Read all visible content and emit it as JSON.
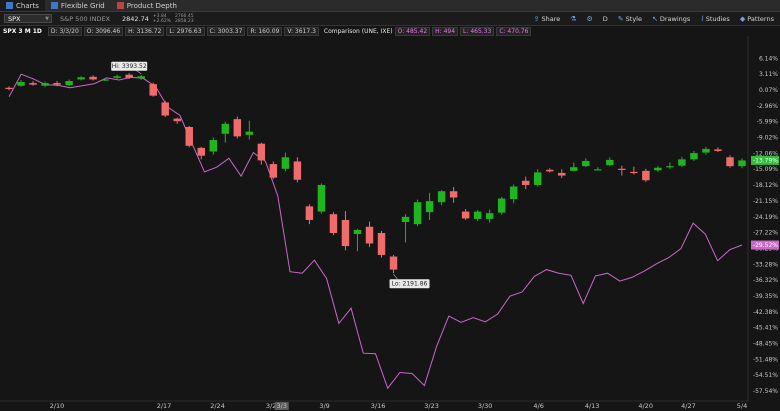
{
  "tabs": [
    {
      "label": "Charts",
      "active": true
    },
    {
      "label": "Flexible Grid",
      "active": false
    },
    {
      "label": "Product Depth",
      "active": false
    }
  ],
  "toolbar": {
    "symbol": "SPX",
    "name": "S&P 500 INDEX",
    "last": "2842.74",
    "change1": "+3.84",
    "change2": "+2.62%",
    "change3": "2766.45",
    "change4": "2858.23",
    "share": "Share",
    "style": "Style",
    "drawings": "Drawings",
    "studies": "Studies",
    "patterns": "Patterns",
    "period_letter": "D"
  },
  "legend": {
    "label": "SPX 3 M 1D",
    "date": "D: 3/3/20",
    "open": "O: 3096.46",
    "high": "H: 3136.72",
    "low": "L: 2976.63",
    "close": "C: 3003.37",
    "change": "R: 160.09",
    "volume": "V: 3617.3",
    "comparison": "Comparison (UNE, IXE)",
    "c_open": "O: 485.42",
    "c_high": "H: 494",
    "c_low": "L: 465.33",
    "c_close": "C: 470.76"
  },
  "colors": {
    "up": "#1fb51f",
    "down": "#f06c6c",
    "comparison": "#c968c8",
    "current_price_tag": "#2fbf3b",
    "comparison_tag": "#c968c8"
  },
  "chart_data": {
    "type": "candlestick",
    "y_axis_labels": [
      "6.14%",
      "3.11%",
      "0.07%",
      "-2.96%",
      "-5.99%",
      "-9.02%",
      "-12.06%",
      "-15.09%",
      "-18.12%",
      "-21.15%",
      "-24.19%",
      "-27.22%",
      "-30.25%",
      "-33.28%",
      "-36.32%",
      "-39.35%",
      "-42.38%",
      "-45.41%",
      "-48.45%",
      "-51.48%",
      "-54.51%",
      "-57.54%"
    ],
    "x_axis_labels": [
      "2/10",
      "2/17",
      "2/24",
      "3/2",
      "3/3",
      "3/9",
      "3/16",
      "3/23",
      "3/30",
      "4/6",
      "4/13",
      "4/20",
      "4/27",
      "5/4"
    ],
    "highlighted_x_label": "3/3",
    "candles": [
      {
        "o": 0.5,
        "c": 0.3,
        "h": 0.8,
        "l": 0.0
      },
      {
        "o": 0.9,
        "c": 1.6,
        "h": 2.0,
        "l": 0.7
      },
      {
        "o": 1.4,
        "c": 1.1,
        "h": 1.8,
        "l": 0.9
      },
      {
        "o": 0.9,
        "c": 1.4,
        "h": 1.7,
        "l": 0.6
      },
      {
        "o": 1.4,
        "c": 1.1,
        "h": 1.8,
        "l": 0.8
      },
      {
        "o": 1.0,
        "c": 1.8,
        "h": 2.1,
        "l": 0.8
      },
      {
        "o": 2.1,
        "c": 2.5,
        "h": 2.7,
        "l": 1.9
      },
      {
        "o": 2.6,
        "c": 2.1,
        "h": 2.9,
        "l": 1.9
      },
      {
        "o": 2.0,
        "c": 2.1,
        "h": 2.4,
        "l": 1.8
      },
      {
        "o": 2.4,
        "c": 2.7,
        "h": 3.0,
        "l": 2.2
      },
      {
        "o": 3.0,
        "c": 2.4,
        "h": 3.3,
        "l": 2.2
      },
      {
        "o": 2.3,
        "c": 2.7,
        "h": 3.0,
        "l": 2.0
      },
      {
        "o": 1.2,
        "c": -1.0,
        "h": 1.5,
        "l": -1.2
      },
      {
        "o": -2.3,
        "c": -4.8,
        "h": -2.0,
        "l": -5.1
      },
      {
        "o": -5.4,
        "c": -5.9,
        "h": -5.2,
        "l": -6.4
      },
      {
        "o": -7.0,
        "c": -10.6,
        "h": -6.8,
        "l": -10.9
      },
      {
        "o": -11.0,
        "c": -12.5,
        "h": -10.8,
        "l": -13.2
      },
      {
        "o": -11.7,
        "c": -9.5,
        "h": -9.0,
        "l": -12.3
      },
      {
        "o": -8.3,
        "c": -6.4,
        "h": -6.0,
        "l": -10.0
      },
      {
        "o": -5.5,
        "c": -8.8,
        "h": -5.0,
        "l": -9.2
      },
      {
        "o": -8.5,
        "c": -7.9,
        "h": -5.8,
        "l": -9.4
      },
      {
        "o": -10.2,
        "c": -13.4,
        "h": -10.0,
        "l": -14.2
      },
      {
        "o": -14.1,
        "c": -16.7,
        "h": -13.6,
        "l": -17.0
      },
      {
        "o": -15.0,
        "c": -12.8,
        "h": -11.9,
        "l": -15.5
      },
      {
        "o": -13.6,
        "c": -17.1,
        "h": -12.8,
        "l": -17.6
      },
      {
        "o": -22.2,
        "c": -24.8,
        "h": -21.8,
        "l": -25.6
      },
      {
        "o": -23.2,
        "c": -18.1,
        "h": -17.8,
        "l": -23.6
      },
      {
        "o": -23.7,
        "c": -27.3,
        "h": -23.3,
        "l": -27.7
      },
      {
        "o": -24.8,
        "c": -29.8,
        "h": -23.1,
        "l": -30.6
      },
      {
        "o": -27.5,
        "c": -26.7,
        "h": -26.5,
        "l": -30.8
      },
      {
        "o": -26.1,
        "c": -29.3,
        "h": -25.1,
        "l": -30.0
      },
      {
        "o": -27.3,
        "c": -31.5,
        "h": -26.9,
        "l": -32.0
      },
      {
        "o": -31.8,
        "c": -34.3,
        "h": -31.5,
        "l": -35.0
      },
      {
        "o": -25.2,
        "c": -24.2,
        "h": -23.7,
        "l": -29.1
      },
      {
        "o": -25.6,
        "c": -21.4,
        "h": -20.9,
        "l": -26.0
      },
      {
        "o": -23.3,
        "c": -21.2,
        "h": -19.6,
        "l": -24.8
      },
      {
        "o": -21.4,
        "c": -19.3,
        "h": -19.1,
        "l": -22.0
      },
      {
        "o": -19.3,
        "c": -20.5,
        "h": -18.5,
        "l": -21.5
      },
      {
        "o": -23.2,
        "c": -24.5,
        "h": -22.7,
        "l": -24.8
      },
      {
        "o": -24.6,
        "c": -23.2,
        "h": -22.9,
        "l": -25.0
      },
      {
        "o": -24.6,
        "c": -23.5,
        "h": -22.8,
        "l": -25.3
      },
      {
        "o": -23.4,
        "c": -20.7,
        "h": -20.4,
        "l": -23.8
      },
      {
        "o": -20.8,
        "c": -18.4,
        "h": -18.0,
        "l": -21.6
      },
      {
        "o": -17.3,
        "c": -18.1,
        "h": -16.5,
        "l": -18.9
      },
      {
        "o": -18.1,
        "c": -15.7,
        "h": -15.1,
        "l": -18.4
      },
      {
        "o": -15.2,
        "c": -15.5,
        "h": -14.9,
        "l": -15.7
      },
      {
        "o": -15.8,
        "c": -16.3,
        "h": -15.1,
        "l": -16.8
      },
      {
        "o": -15.4,
        "c": -14.7,
        "h": -13.8,
        "l": -15.5
      },
      {
        "o": -14.5,
        "c": -13.5,
        "h": -13.0,
        "l": -14.7
      },
      {
        "o": -15.1,
        "c": -15.1,
        "h": -14.7,
        "l": -15.3
      },
      {
        "o": -14.3,
        "c": -13.3,
        "h": -12.8,
        "l": -14.5
      },
      {
        "o": -15.0,
        "c": -15.2,
        "h": -14.4,
        "l": -16.3
      },
      {
        "o": -15.6,
        "c": -15.8,
        "h": -14.6,
        "l": -16.1
      },
      {
        "o": -15.4,
        "c": -17.2,
        "h": -15.0,
        "l": -17.5
      },
      {
        "o": -15.3,
        "c": -14.8,
        "h": -14.5,
        "l": -15.6
      },
      {
        "o": -14.6,
        "c": -14.5,
        "h": -13.8,
        "l": -15.0
      },
      {
        "o": -14.4,
        "c": -13.2,
        "h": -12.7,
        "l": -14.7
      },
      {
        "o": -13.2,
        "c": -12.0,
        "h": -11.6,
        "l": -13.5
      },
      {
        "o": -11.9,
        "c": -11.2,
        "h": -10.8,
        "l": -12.3
      },
      {
        "o": -11.3,
        "c": -11.6,
        "h": -10.9,
        "l": -11.8
      },
      {
        "o": -12.8,
        "c": -14.5,
        "h": -12.4,
        "l": -14.8
      },
      {
        "o": -14.5,
        "c": -13.4,
        "h": -13.0,
        "l": -14.9
      }
    ],
    "comparison_series": [
      {
        "i": 0,
        "v": -1.2
      },
      {
        "i": 1,
        "v": 3.1
      },
      {
        "i": 2,
        "v": 2.2
      },
      {
        "i": 3,
        "v": 1.1
      },
      {
        "i": 4,
        "v": 1.0
      },
      {
        "i": 5,
        "v": 0.5
      },
      {
        "i": 6,
        "v": 0.9
      },
      {
        "i": 7,
        "v": 1.3
      },
      {
        "i": 8,
        "v": 2.4
      },
      {
        "i": 9,
        "v": 2.0
      },
      {
        "i": 10,
        "v": 2.5
      },
      {
        "i": 11,
        "v": 2.3
      },
      {
        "i": 12,
        "v": 0.7
      },
      {
        "i": 13,
        "v": -3.2
      },
      {
        "i": 14,
        "v": -4.8
      },
      {
        "i": 15,
        "v": -10.3
      },
      {
        "i": 16,
        "v": -15.6
      },
      {
        "i": 17,
        "v": -14.7
      },
      {
        "i": 18,
        "v": -13.0
      },
      {
        "i": 19,
        "v": -16.4
      },
      {
        "i": 20,
        "v": -11.9
      },
      {
        "i": 21,
        "v": -13.6
      },
      {
        "i": 22,
        "v": -20.2
      },
      {
        "i": 23,
        "v": -34.7
      },
      {
        "i": 24,
        "v": -35.0
      },
      {
        "i": 25,
        "v": -32.5
      },
      {
        "i": 26,
        "v": -36.0
      },
      {
        "i": 27,
        "v": -44.6
      },
      {
        "i": 28,
        "v": -41.7
      },
      {
        "i": 29,
        "v": -50.3
      },
      {
        "i": 30,
        "v": -50.4
      },
      {
        "i": 31,
        "v": -57.0
      },
      {
        "i": 32,
        "v": -54.0
      },
      {
        "i": 33,
        "v": -54.2
      },
      {
        "i": 34,
        "v": -56.5
      },
      {
        "i": 35,
        "v": -49.0
      },
      {
        "i": 36,
        "v": -43.2
      },
      {
        "i": 37,
        "v": -44.4
      },
      {
        "i": 38,
        "v": -43.5
      },
      {
        "i": 39,
        "v": -44.3
      },
      {
        "i": 40,
        "v": -42.8
      },
      {
        "i": 41,
        "v": -39.4
      },
      {
        "i": 42,
        "v": -38.6
      },
      {
        "i": 43,
        "v": -35.6
      },
      {
        "i": 44,
        "v": -34.3
      },
      {
        "i": 45,
        "v": -35.0
      },
      {
        "i": 46,
        "v": -35.4
      },
      {
        "i": 47,
        "v": -40.8
      },
      {
        "i": 48,
        "v": -35.5
      },
      {
        "i": 49,
        "v": -35.0
      },
      {
        "i": 50,
        "v": -36.5
      },
      {
        "i": 51,
        "v": -35.8
      },
      {
        "i": 52,
        "v": -34.6
      },
      {
        "i": 53,
        "v": -33.2
      },
      {
        "i": 54,
        "v": -32.0
      },
      {
        "i": 55,
        "v": -30.3
      },
      {
        "i": 56,
        "v": -25.4
      },
      {
        "i": 57,
        "v": -27.5
      },
      {
        "i": 58,
        "v": -32.6
      },
      {
        "i": 59,
        "v": -30.5
      },
      {
        "i": 60,
        "v": -29.6
      }
    ],
    "annotations": [
      {
        "text": "Hi: 3393.52"
      },
      {
        "text": "Lo: 2191.86"
      }
    ],
    "price_tag": "-13.79%",
    "comparison_tag": "-29.52%",
    "ylim": [
      -58.5,
      8.5
    ]
  }
}
